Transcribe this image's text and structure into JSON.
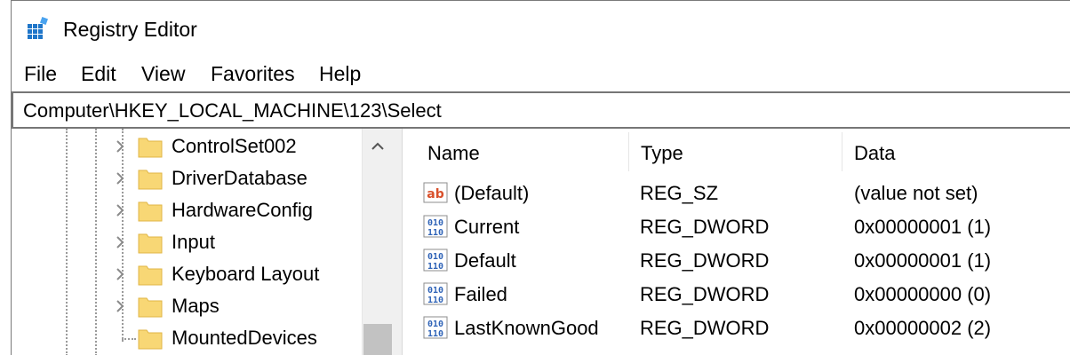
{
  "window": {
    "title": "Registry Editor"
  },
  "menu": [
    "File",
    "Edit",
    "View",
    "Favorites",
    "Help"
  ],
  "address": "Computer\\HKEY_LOCAL_MACHINE\\123\\Select",
  "tree": {
    "items": [
      {
        "label": "ControlSet002",
        "expandable": true
      },
      {
        "label": "DriverDatabase",
        "expandable": true
      },
      {
        "label": "HardwareConfig",
        "expandable": true
      },
      {
        "label": "Input",
        "expandable": true
      },
      {
        "label": "Keyboard Layout",
        "expandable": true
      },
      {
        "label": "Maps",
        "expandable": true
      },
      {
        "label": "MountedDevices",
        "expandable": false
      }
    ]
  },
  "list": {
    "columns": [
      "Name",
      "Type",
      "Data"
    ],
    "rows": [
      {
        "icon": "string-value-icon",
        "name": "(Default)",
        "type": "REG_SZ",
        "data": "(value not set)"
      },
      {
        "icon": "binary-value-icon",
        "name": "Current",
        "type": "REG_DWORD",
        "data": "0x00000001 (1)"
      },
      {
        "icon": "binary-value-icon",
        "name": "Default",
        "type": "REG_DWORD",
        "data": "0x00000001 (1)"
      },
      {
        "icon": "binary-value-icon",
        "name": "Failed",
        "type": "REG_DWORD",
        "data": "0x00000000 (0)"
      },
      {
        "icon": "binary-value-icon",
        "name": "LastKnownGood",
        "type": "REG_DWORD",
        "data": "0x00000002 (2)"
      }
    ]
  },
  "colors": {
    "folder_fill": "#f8d775",
    "folder_stroke": "#e0b645",
    "string_icon_red": "#d9502b",
    "binary_icon_blue": "#2f63b7",
    "app_icon_blue": "#1f76c9",
    "scroll_thumb": "#c2c2c2"
  }
}
